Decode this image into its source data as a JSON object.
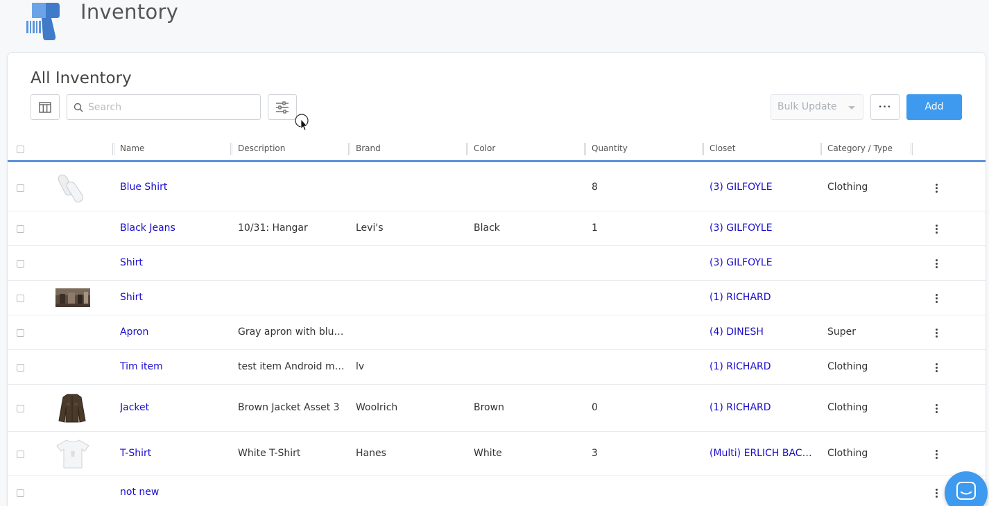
{
  "app": {
    "title": "Inventory"
  },
  "page": {
    "title": "All Inventory"
  },
  "toolbar": {
    "search_placeholder": "Search",
    "bulk_update_label": "Bulk Update",
    "more_label": "•••",
    "add_label": "Add"
  },
  "table": {
    "headers": [
      "Name",
      "Description",
      "Brand",
      "Color",
      "Quantity",
      "Closet",
      "Category / Type"
    ],
    "rows": [
      {
        "name": "Blue Shirt",
        "description": "",
        "brand": "",
        "color": "",
        "quantity": "8",
        "closet": "(3) GILFOYLE",
        "category": "Clothing",
        "thumb": "socks"
      },
      {
        "name": "Black Jeans",
        "description": "10/31: Hangar",
        "brand": "Levi's",
        "color": "Black",
        "quantity": "1",
        "closet": "(3) GILFOYLE",
        "category": "",
        "thumb": ""
      },
      {
        "name": "Shirt",
        "description": "",
        "brand": "",
        "color": "",
        "quantity": "",
        "closet": "(3) GILFOYLE",
        "category": "",
        "thumb": ""
      },
      {
        "name": "Shirt",
        "description": "",
        "brand": "",
        "color": "",
        "quantity": "",
        "closet": "(1) RICHARD",
        "category": "",
        "thumb": "photo"
      },
      {
        "name": "Apron",
        "description": "Gray apron with blue ...",
        "brand": "",
        "color": "",
        "quantity": "",
        "closet": "(4) DINESH",
        "category": "Super",
        "thumb": ""
      },
      {
        "name": "Tim item",
        "description": "test item Android mo...",
        "brand": "lv",
        "color": "",
        "quantity": "",
        "closet": "(1) RICHARD",
        "category": "Clothing",
        "thumb": ""
      },
      {
        "name": "Jacket",
        "description": "Brown Jacket Asset 3",
        "brand": "Woolrich",
        "color": "Brown",
        "quantity": "0",
        "closet": "(1) RICHARD",
        "category": "Clothing",
        "thumb": "jacket"
      },
      {
        "name": "T-Shirt",
        "description": "White T-Shirt",
        "brand": "Hanes",
        "color": "White",
        "quantity": "3",
        "closet": "(Multi) ERLICH BACH...",
        "category": "Clothing",
        "thumb": "tshirt"
      },
      {
        "name": "not new",
        "description": "",
        "brand": "",
        "color": "",
        "quantity": "",
        "closet": "",
        "category": "",
        "thumb": ""
      }
    ]
  },
  "colors": {
    "accent": "#3d9aee",
    "link": "#1a0dcc",
    "header_rule": "#5a92d8"
  },
  "icons": [
    "barcode-scanner-logo-icon",
    "columns-icon",
    "search-icon",
    "filter-sliders-icon",
    "more-icon",
    "kebab-icon",
    "chat-icon"
  ]
}
